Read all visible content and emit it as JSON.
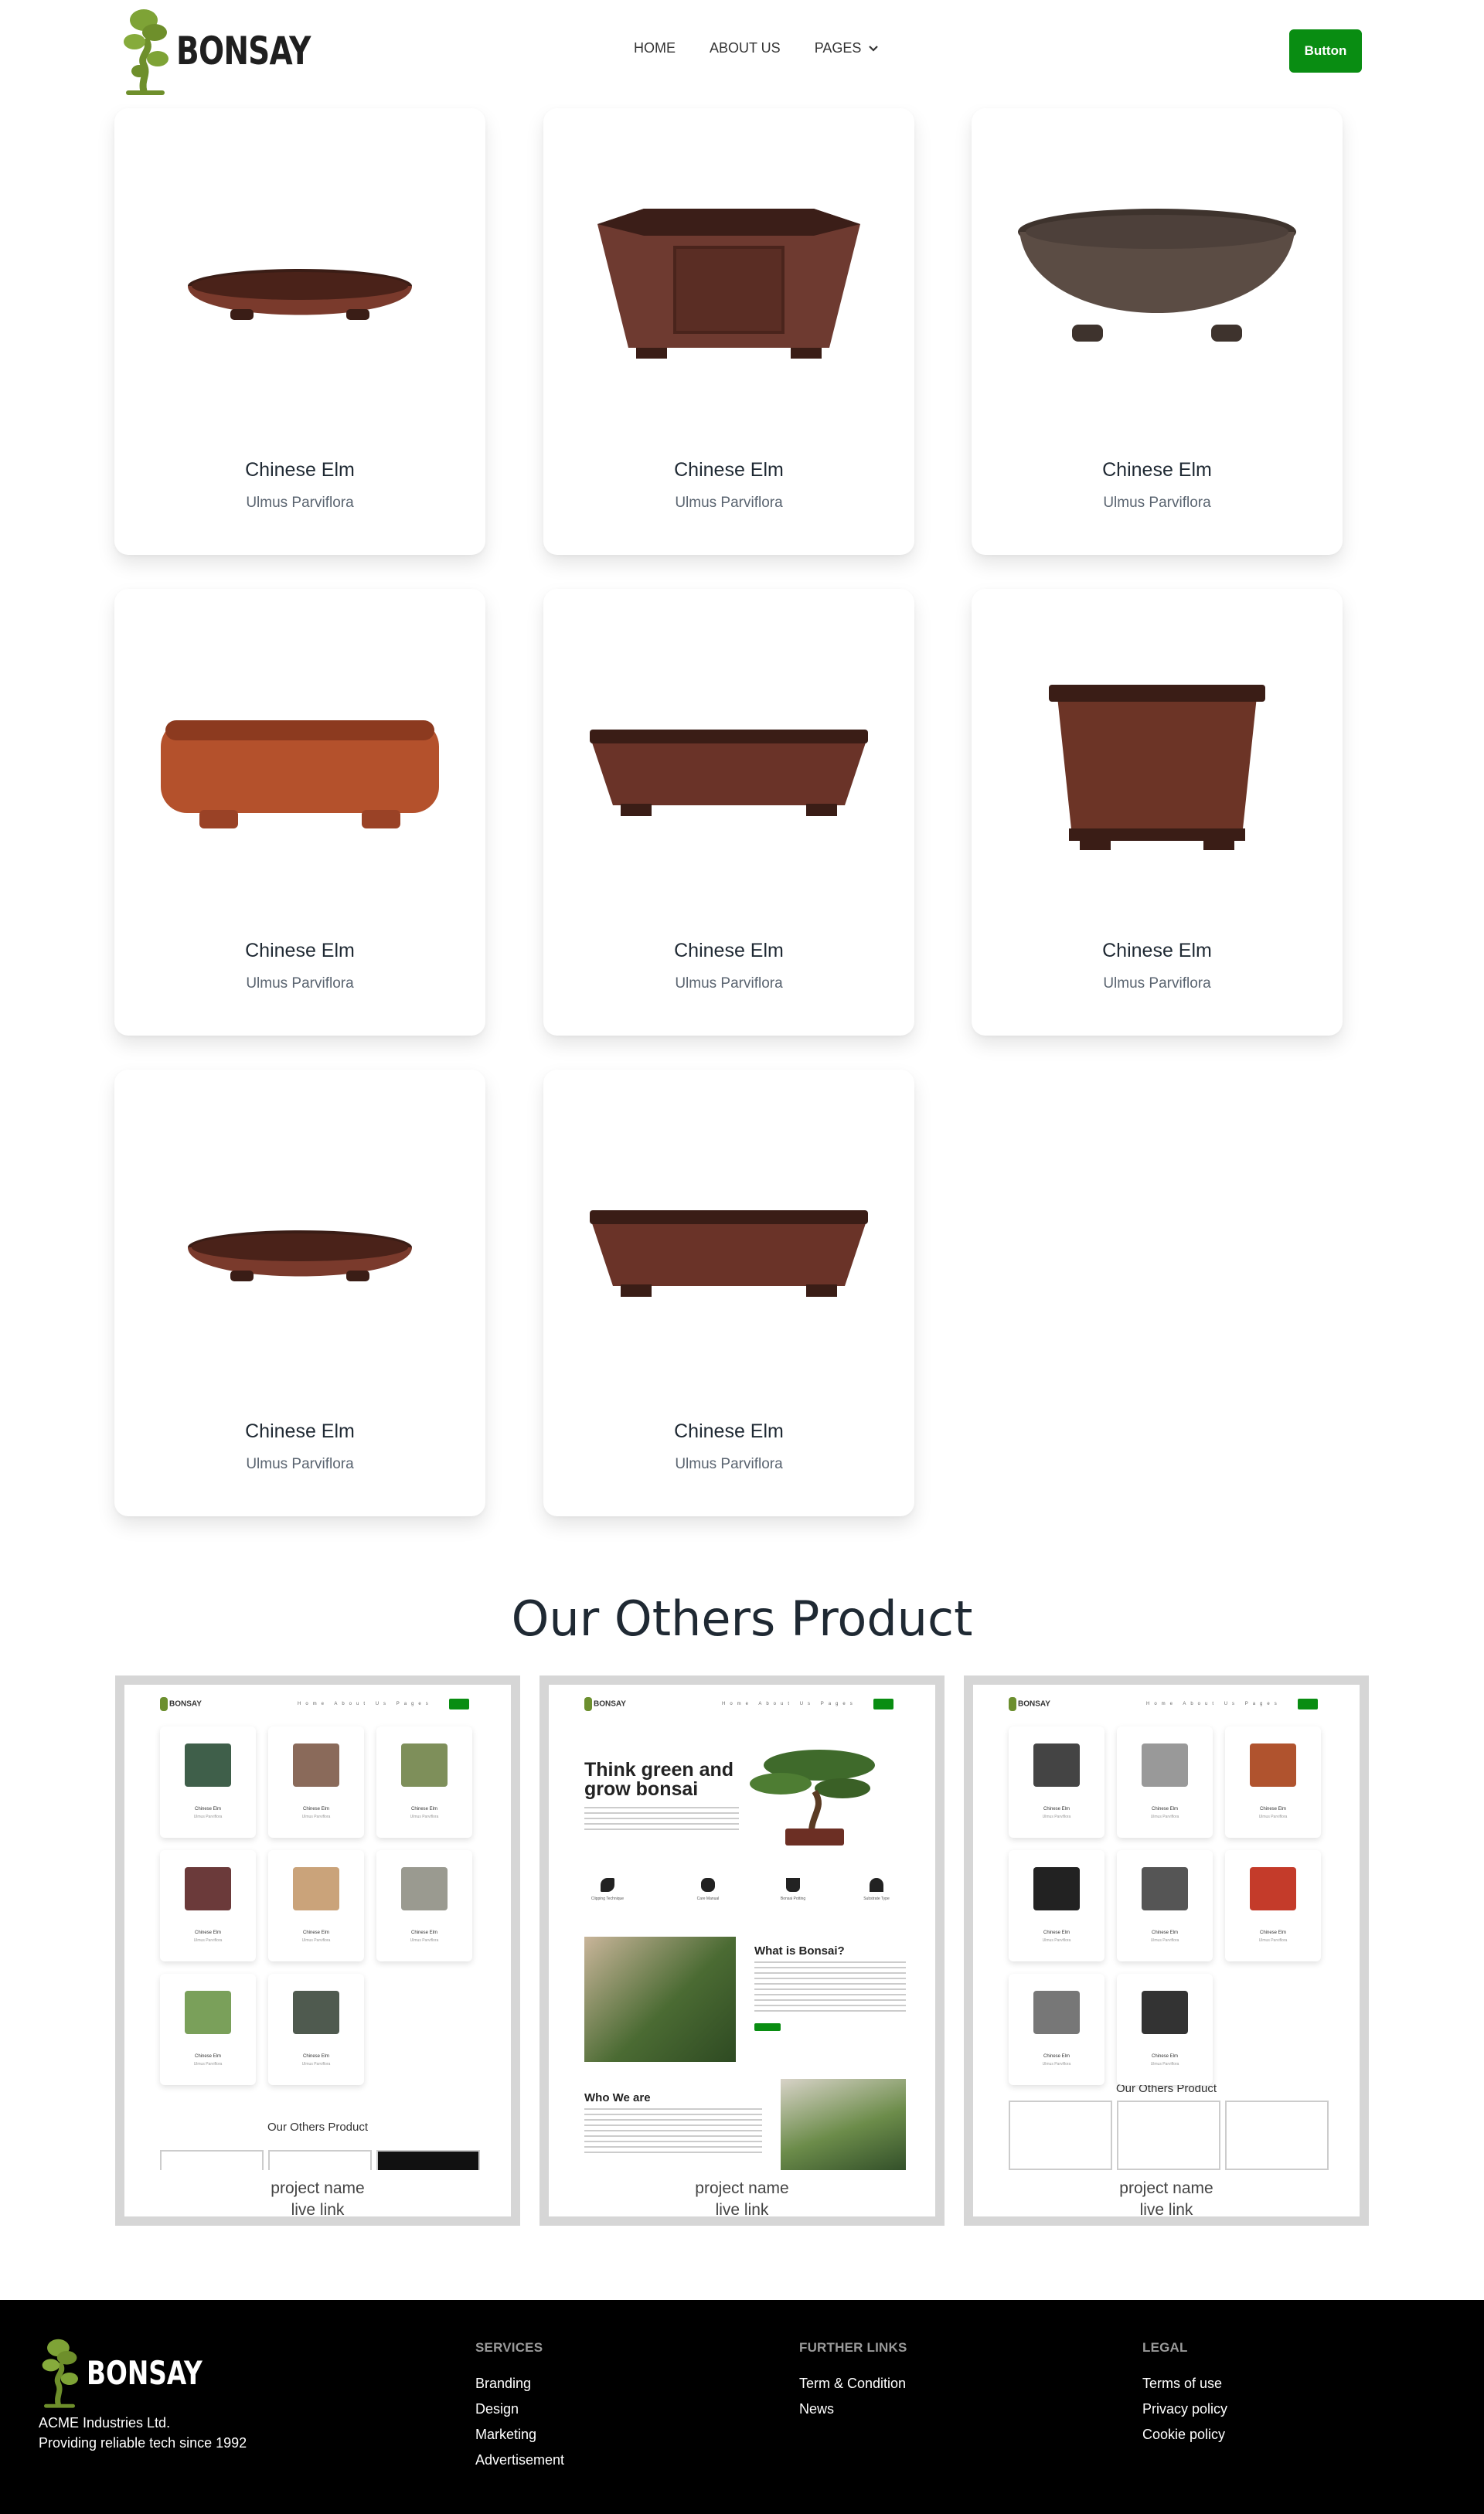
{
  "header": {
    "brand": "BONSAY",
    "nav": [
      "HOME",
      "ABOUT US",
      "PAGES"
    ],
    "button_label": "Button",
    "accent_color": "#098d12"
  },
  "products": [
    {
      "name": "Chinese Elm",
      "sub": "Ulmus Parviflora",
      "pot": "oval-shallow",
      "color": "#7a3a2c"
    },
    {
      "name": "Chinese Elm",
      "sub": "Ulmus Parviflora",
      "pot": "hexagonal",
      "color": "#6e3a30"
    },
    {
      "name": "Chinese Elm",
      "sub": "Ulmus Parviflora",
      "pot": "oval-deep",
      "color": "#5b4c44"
    },
    {
      "name": "Chinese Elm",
      "sub": "Ulmus Parviflora",
      "pot": "rect-orange",
      "color": "#b4512c"
    },
    {
      "name": "Chinese Elm",
      "sub": "Ulmus Parviflora",
      "pot": "rect-shallow",
      "color": "#6a3328"
    },
    {
      "name": "Chinese Elm",
      "sub": "Ulmus Parviflora",
      "pot": "square-deep",
      "color": "#6c3426"
    },
    {
      "name": "Chinese Elm",
      "sub": "Ulmus Parviflora",
      "pot": "oval-shallow",
      "color": "#7a3a2c"
    },
    {
      "name": "Chinese Elm",
      "sub": "Ulmus Parviflora",
      "pot": "rect-shallow",
      "color": "#6a3328"
    }
  ],
  "others": {
    "title": "Our Others Product",
    "projects": [
      {
        "name": "project name",
        "link": "live link",
        "mini_brand": "BONSAY",
        "mini_nav": "Home About Us Pages",
        "cards": [
          {
            "name": "Chinese Elm",
            "sub": "Ulmus Parviflora"
          },
          {
            "name": "Chinese Elm",
            "sub": "Ulmus Parviflora"
          },
          {
            "name": "Chinese Elm",
            "sub": "Ulmus Parviflora"
          },
          {
            "name": "Chinese Elm",
            "sub": "Ulmus Parviflora"
          },
          {
            "name": "Chinese Elm",
            "sub": "Ulmus Parviflora"
          },
          {
            "name": "Chinese Elm",
            "sub": "Ulmus Parviflora"
          },
          {
            "name": "Chinese Elm",
            "sub": "Ulmus Parviflora"
          },
          {
            "name": "Chinese Elm",
            "sub": "Ulmus Parviflora"
          }
        ],
        "mini_title": "Our Others Product"
      },
      {
        "name": "project name",
        "link": "live link",
        "mini_brand": "BONSAY",
        "mini_nav": "Home About Us Pages",
        "hero": "Think green and grow bonsai",
        "icons": [
          "Clipping Technique",
          "Care Manual",
          "Bonsai Potting",
          "Substrate Type"
        ],
        "what": "What is Bonsai?",
        "who": "Who We are"
      },
      {
        "name": "project name",
        "link": "live link",
        "mini_brand": "BONSAY",
        "mini_nav": "Home About Us Pages",
        "cards": [
          {
            "name": "Chinese Elm",
            "sub": "Ulmus Parviflora"
          },
          {
            "name": "Chinese Elm",
            "sub": "Ulmus Parviflora"
          },
          {
            "name": "Chinese Elm",
            "sub": "Ulmus Parviflora"
          },
          {
            "name": "Chinese Elm",
            "sub": "Ulmus Parviflora"
          },
          {
            "name": "Chinese Elm",
            "sub": "Ulmus Parviflora"
          },
          {
            "name": "Chinese Elm",
            "sub": "Ulmus Parviflora"
          },
          {
            "name": "Chinese Elm",
            "sub": "Ulmus Parviflora"
          },
          {
            "name": "Chinese Elm",
            "sub": "Ulmus Parviflora"
          }
        ],
        "mini_title": "Our Others Product"
      }
    ]
  },
  "footer": {
    "brand": "BONSAY",
    "company_line1": "ACME Industries Ltd.",
    "company_line2": "Providing reliable tech since 1992",
    "columns": [
      {
        "title": "SERVICES",
        "links": [
          "Branding",
          "Design",
          "Marketing",
          "Advertisement"
        ]
      },
      {
        "title": "FURTHER LINKS",
        "links": [
          "Term & Condition",
          "News"
        ]
      },
      {
        "title": "LEGAL",
        "links": [
          "Terms of use",
          "Privacy policy",
          "Cookie policy"
        ]
      }
    ]
  }
}
